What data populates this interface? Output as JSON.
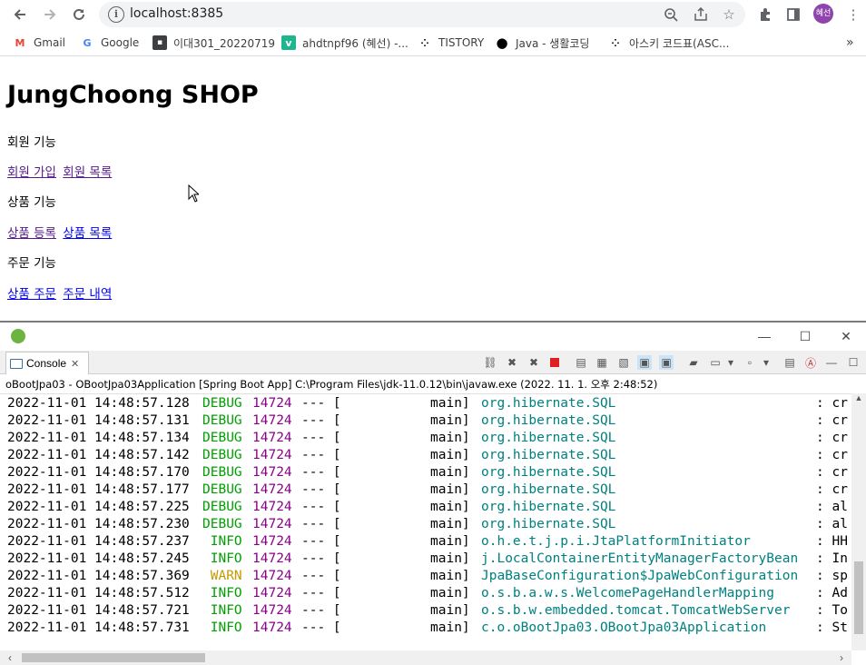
{
  "browser": {
    "url": "localhost:8385",
    "profile_initials": "혜선",
    "bookmarks": [
      {
        "label": "Gmail",
        "icon": "gmail-icon"
      },
      {
        "label": "Google",
        "icon": "google-icon"
      },
      {
        "label": "이대301_20220719",
        "icon": "contact-card-icon"
      },
      {
        "label": "ahdtnpf96 (혜선) -...",
        "icon": "vscode-v-icon"
      },
      {
        "label": "TISTORY",
        "icon": "tistory-dots-icon"
      },
      {
        "label": "Java - 생활코딩",
        "icon": "black-circle-icon"
      },
      {
        "label": "아스키 코드표(ASC...",
        "icon": "tistory-dots-icon"
      }
    ],
    "more_bookmarks": "»"
  },
  "page": {
    "title": "JungChoong SHOP",
    "sections": [
      {
        "heading": "회원 기능",
        "links": [
          "회원 가입",
          "회원 목록"
        ]
      },
      {
        "heading": "상품 기능",
        "links": [
          "상품 등록",
          "상품 목록"
        ]
      },
      {
        "heading": "주문 기능",
        "links": [
          "상품 주문",
          "주문 내역"
        ]
      }
    ]
  },
  "eclipse": {
    "tab_label": "Console",
    "process_line": "oBootJpa03 - OBootJpa03Application [Spring Boot App] C:\\Program Files\\jdk-11.0.12\\bin\\javaw.exe  (2022. 11. 1. 오후 2:48:52)",
    "logs": [
      {
        "ts": "2022-11-01 14:48:57.128",
        "level": "DEBUG",
        "pid": "14724",
        "sep": "--- [",
        "thread": "main]",
        "logger": "org.hibernate.SQL",
        "msg": ": cr"
      },
      {
        "ts": "2022-11-01 14:48:57.131",
        "level": "DEBUG",
        "pid": "14724",
        "sep": "--- [",
        "thread": "main]",
        "logger": "org.hibernate.SQL",
        "msg": ": cr"
      },
      {
        "ts": "2022-11-01 14:48:57.134",
        "level": "DEBUG",
        "pid": "14724",
        "sep": "--- [",
        "thread": "main]",
        "logger": "org.hibernate.SQL",
        "msg": ": cr"
      },
      {
        "ts": "2022-11-01 14:48:57.142",
        "level": "DEBUG",
        "pid": "14724",
        "sep": "--- [",
        "thread": "main]",
        "logger": "org.hibernate.SQL",
        "msg": ": cr"
      },
      {
        "ts": "2022-11-01 14:48:57.170",
        "level": "DEBUG",
        "pid": "14724",
        "sep": "--- [",
        "thread": "main]",
        "logger": "org.hibernate.SQL",
        "msg": ": cr"
      },
      {
        "ts": "2022-11-01 14:48:57.177",
        "level": "DEBUG",
        "pid": "14724",
        "sep": "--- [",
        "thread": "main]",
        "logger": "org.hibernate.SQL",
        "msg": ": cr"
      },
      {
        "ts": "2022-11-01 14:48:57.225",
        "level": "DEBUG",
        "pid": "14724",
        "sep": "--- [",
        "thread": "main]",
        "logger": "org.hibernate.SQL",
        "msg": ": al"
      },
      {
        "ts": "2022-11-01 14:48:57.230",
        "level": "DEBUG",
        "pid": "14724",
        "sep": "--- [",
        "thread": "main]",
        "logger": "org.hibernate.SQL",
        "msg": ": al"
      },
      {
        "ts": "2022-11-01 14:48:57.237",
        "level": " INFO",
        "pid": "14724",
        "sep": "--- [",
        "thread": "main]",
        "logger": "o.h.e.t.j.p.i.JtaPlatformInitiator",
        "msg": ": HH"
      },
      {
        "ts": "2022-11-01 14:48:57.245",
        "level": " INFO",
        "pid": "14724",
        "sep": "--- [",
        "thread": "main]",
        "logger": "j.LocalContainerEntityManagerFactoryBean",
        "msg": ": In"
      },
      {
        "ts": "2022-11-01 14:48:57.369",
        "level": " WARN",
        "pid": "14724",
        "sep": "--- [",
        "thread": "main]",
        "logger": "JpaBaseConfiguration$JpaWebConfiguration",
        "msg": ": sp"
      },
      {
        "ts": "2022-11-01 14:48:57.512",
        "level": " INFO",
        "pid": "14724",
        "sep": "--- [",
        "thread": "main]",
        "logger": "o.s.b.a.w.s.WelcomePageHandlerMapping",
        "msg": ": Ad"
      },
      {
        "ts": "2022-11-01 14:48:57.721",
        "level": " INFO",
        "pid": "14724",
        "sep": "--- [",
        "thread": "main]",
        "logger": "o.s.b.w.embedded.tomcat.TomcatWebServer",
        "msg": ": To"
      },
      {
        "ts": "2022-11-01 14:48:57.731",
        "level": " INFO",
        "pid": "14724",
        "sep": "--- [",
        "thread": "main]",
        "logger": "c.o.oBootJpa03.OBootJpa03Application",
        "msg": ": St"
      }
    ]
  },
  "colors": {
    "link": "#0000ee",
    "visited_link": "#551a8b",
    "debug_info": "#00a000",
    "warn": "#c49a00",
    "pid": "#8b008b",
    "logger": "#008080"
  }
}
